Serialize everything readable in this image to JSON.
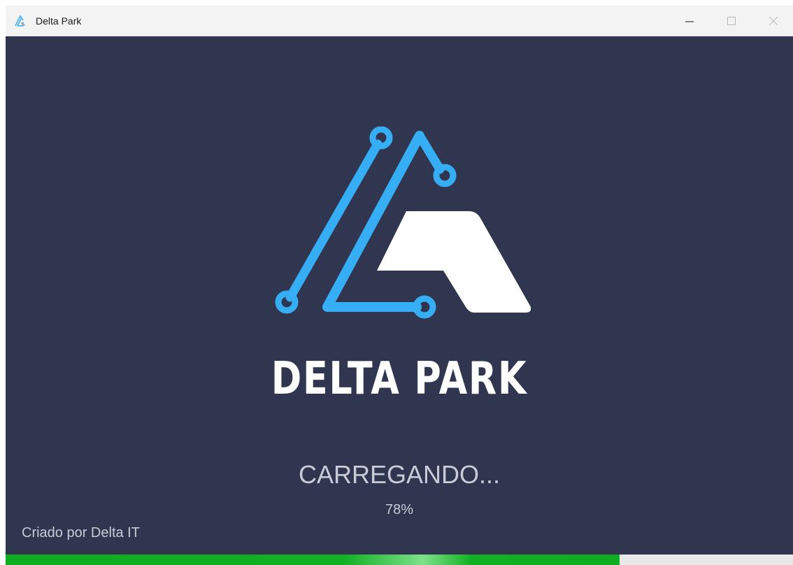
{
  "window": {
    "title": "Delta Park",
    "icon": "delta-logo-icon",
    "controls": {
      "minimize_icon": "minimize-icon",
      "maximize_icon": "maximize-icon",
      "close_icon": "close-icon"
    }
  },
  "splash": {
    "logo_icon": "delta-park-logo",
    "brand_name": "DELTA PARK",
    "status_text": "CARREGANDO...",
    "progress_text": "78%",
    "progress_value": 78,
    "credit_text": "Criado por Delta IT"
  },
  "colors": {
    "background": "#30364f",
    "logo_blue": "#36aef5",
    "logo_white": "#ffffff",
    "progress_green": "#10b022",
    "progress_track": "#e8e8e8",
    "muted_text": "#c9ccd6"
  }
}
